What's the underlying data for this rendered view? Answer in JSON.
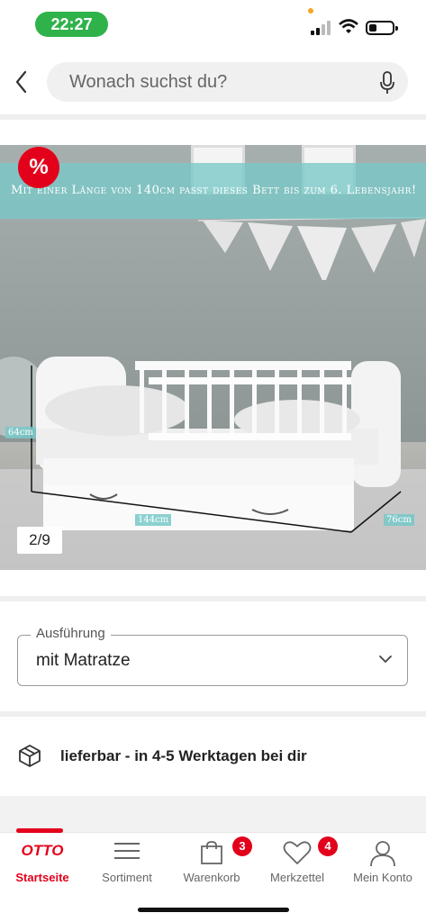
{
  "status_bar": {
    "time": "22:27"
  },
  "search": {
    "placeholder": "Wonach suchst du?"
  },
  "product_image": {
    "sale_badge": "%",
    "banner_text": "Mit einer Länge von 140cm passt dieses Bett bis zum 6. Lebensjahr!",
    "counter": "2/9",
    "dimensions": {
      "height": "64cm",
      "length": "144cm",
      "depth": "76cm"
    }
  },
  "variant": {
    "legend": "Ausführung",
    "value": "mit Matratze"
  },
  "delivery": {
    "text": "lieferbar - in 4-5 Werktagen bei dir"
  },
  "tab_bar": {
    "items": [
      {
        "label": "Startseite",
        "icon": "otto-logo-icon",
        "active": true,
        "logo_text": "OTTO"
      },
      {
        "label": "Sortiment",
        "icon": "menu-icon"
      },
      {
        "label": "Warenkorb",
        "icon": "shopping-bag-icon",
        "badge": "3"
      },
      {
        "label": "Merkzettel",
        "icon": "heart-icon",
        "badge": "4"
      },
      {
        "label": "Mein Konto",
        "icon": "user-icon"
      }
    ]
  },
  "colors": {
    "accent": "#e3001b",
    "time_pill": "#2fb24a",
    "banner": "#78c8c8"
  }
}
